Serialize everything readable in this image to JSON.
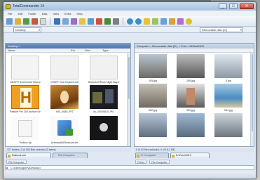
{
  "app": {
    "title": "TotalCommander 14"
  },
  "menu": [
    "File",
    "Edit",
    "Folder",
    "Disk",
    "View",
    "Extra",
    "Help"
  ],
  "drives": {
    "left": "Desktop",
    "right": "Removable disk (D:)"
  },
  "left_panel": {
    "path": "Desktop \\",
    "columns": [
      "Name",
      "Ext",
      "Size",
      "Type"
    ],
    "items": [
      {
        "label": "GRAPH Screenshot Resizer.lnk"
      },
      {
        "label": "CPART Tech Explorer.lnk"
      },
      {
        "label": "Bookshelf Rock Night Bay.mp4"
      },
      {
        "label": "Resizer Pro 250 archive.rar"
      },
      {
        "label": "IMG_4680.JPG"
      },
      {
        "label": "dc_00005810.JPG"
      },
      {
        "label": "Toolbox.zip"
      },
      {
        "label": "UninstallAllShortcuts.lnk"
      },
      {
        "label": ""
      }
    ],
    "status": "127 folders, 0 of 153 files selected (0 bytes)"
  },
  "right_panel": {
    "path": "Computer > Removable disk (D:) > Foto > DiGital2012",
    "items": [
      {
        "label": "105.jpg"
      },
      {
        "label": "206.jpg"
      },
      {
        "label": "3.jpg"
      },
      {
        "label": "552.jpg"
      },
      {
        "label": "353.jpg"
      },
      {
        "label": "544.jpg"
      },
      {
        "label": ""
      },
      {
        "label": ""
      },
      {
        "label": ""
      }
    ],
    "status": "0 of 42 files selected, 0 of 18.2 MB"
  },
  "tabs": {
    "left": [
      "Rabovd.xml",
      "File Computer"
    ],
    "right": [
      "D: Computer",
      "D:\\Foto\\2012"
    ]
  },
  "subtabs": {
    "left": [
      "File Computer"
    ],
    "right": [
      "Folder",
      "File Computer"
    ]
  },
  "cmdline": "C:\\Users\\Igorev\\Desktop>"
}
